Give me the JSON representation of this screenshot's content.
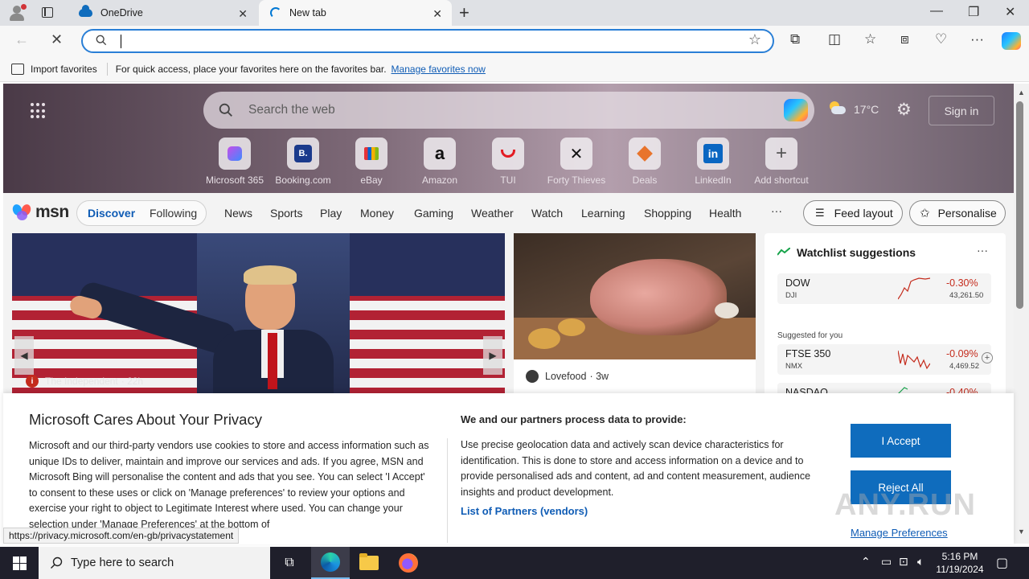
{
  "browser": {
    "tabs": [
      {
        "title": "OneDrive",
        "icon": "onedrive-cloud-icon"
      },
      {
        "title": "New tab",
        "icon": "loading-spinner-icon"
      }
    ],
    "address_bar": {
      "value": "",
      "placeholder": ""
    },
    "favorites_bar": {
      "import_label": "Import favorites",
      "hint": "For quick access, place your favorites here on the favorites bar.",
      "manage_link": "Manage favorites now"
    },
    "status_url": "https://privacy.microsoft.com/en-gb/privacystatement"
  },
  "newtab": {
    "search_placeholder": "Search the web",
    "temperature": "17°C",
    "sign_in": "Sign in",
    "shortcuts": [
      {
        "label": "Microsoft 365",
        "icon": "microsoft365-icon"
      },
      {
        "label": "Booking.com",
        "glyph": "B."
      },
      {
        "label": "eBay",
        "icon": "ebay-bag-icon"
      },
      {
        "label": "Amazon",
        "glyph": "a"
      },
      {
        "label": "TUI",
        "icon": "tui-icon"
      },
      {
        "label": "Forty Thieves",
        "icon": "crossed-swords-icon"
      },
      {
        "label": "Deals",
        "icon": "tag-icon"
      },
      {
        "label": "LinkedIn",
        "glyph": "in"
      },
      {
        "label": "Add shortcut",
        "glyph": "+"
      }
    ],
    "msn_logo": "msn",
    "feed_tabs": {
      "discover": "Discover",
      "following": "Following"
    },
    "categories": [
      "News",
      "Sports",
      "Play",
      "Money",
      "Gaming",
      "Weather",
      "Watch",
      "Learning",
      "Shopping",
      "Health"
    ],
    "more": "···",
    "feed_layout": "Feed layout",
    "personalise": "Personalise",
    "main_card": {
      "source": "The Independent",
      "age": "· 22h"
    },
    "food_card": {
      "source": "Lovefood",
      "age": "· 3w"
    },
    "watchlist": {
      "title": "Watchlist suggestions",
      "more": "···",
      "suggested_label": "Suggested for you",
      "stocks": [
        {
          "name": "DOW",
          "exchange": "DJI",
          "change": "-0.30%",
          "price": "43,261.50"
        },
        {
          "name": "FTSE 350",
          "exchange": "NMX",
          "change": "-0.09%",
          "price": "4,469.52"
        },
        {
          "name": "NASDAQ",
          "exchange": "",
          "change": "-0.40%",
          "price": ""
        }
      ]
    }
  },
  "privacy": {
    "title": "Microsoft Cares About Your Privacy",
    "body": "Microsoft and our third-party vendors use cookies to store and access information such as unique IDs to deliver, maintain and improve our services and ads. If you agree, MSN and Microsoft Bing will personalise the content and ads that you see. You can select 'I Accept' to consent to these uses or click on 'Manage preferences' to review your options and exercise your right to object to Legitimate Interest where used.  You can change your selection under 'Manage Preferences' at the bottom of",
    "right_heading": "We and our partners process data to provide:",
    "right_body": "Use precise geolocation data and actively scan device characteristics for identification. This is done to store and access information on a device and to provide personalised ads and content, ad and content measurement, audience insights and product development.",
    "partners_link": "List of Partners (vendors)",
    "accept": "I Accept",
    "reject": "Reject All",
    "manage": "Manage Preferences",
    "watermark": "ANY.RUN"
  },
  "taskbar": {
    "search_placeholder": "Type here to search",
    "time": "5:16 PM",
    "date": "11/19/2024"
  },
  "colors": {
    "accent": "#0f6cbd",
    "link": "#0f5cb5",
    "negative": "#c42b1c"
  }
}
